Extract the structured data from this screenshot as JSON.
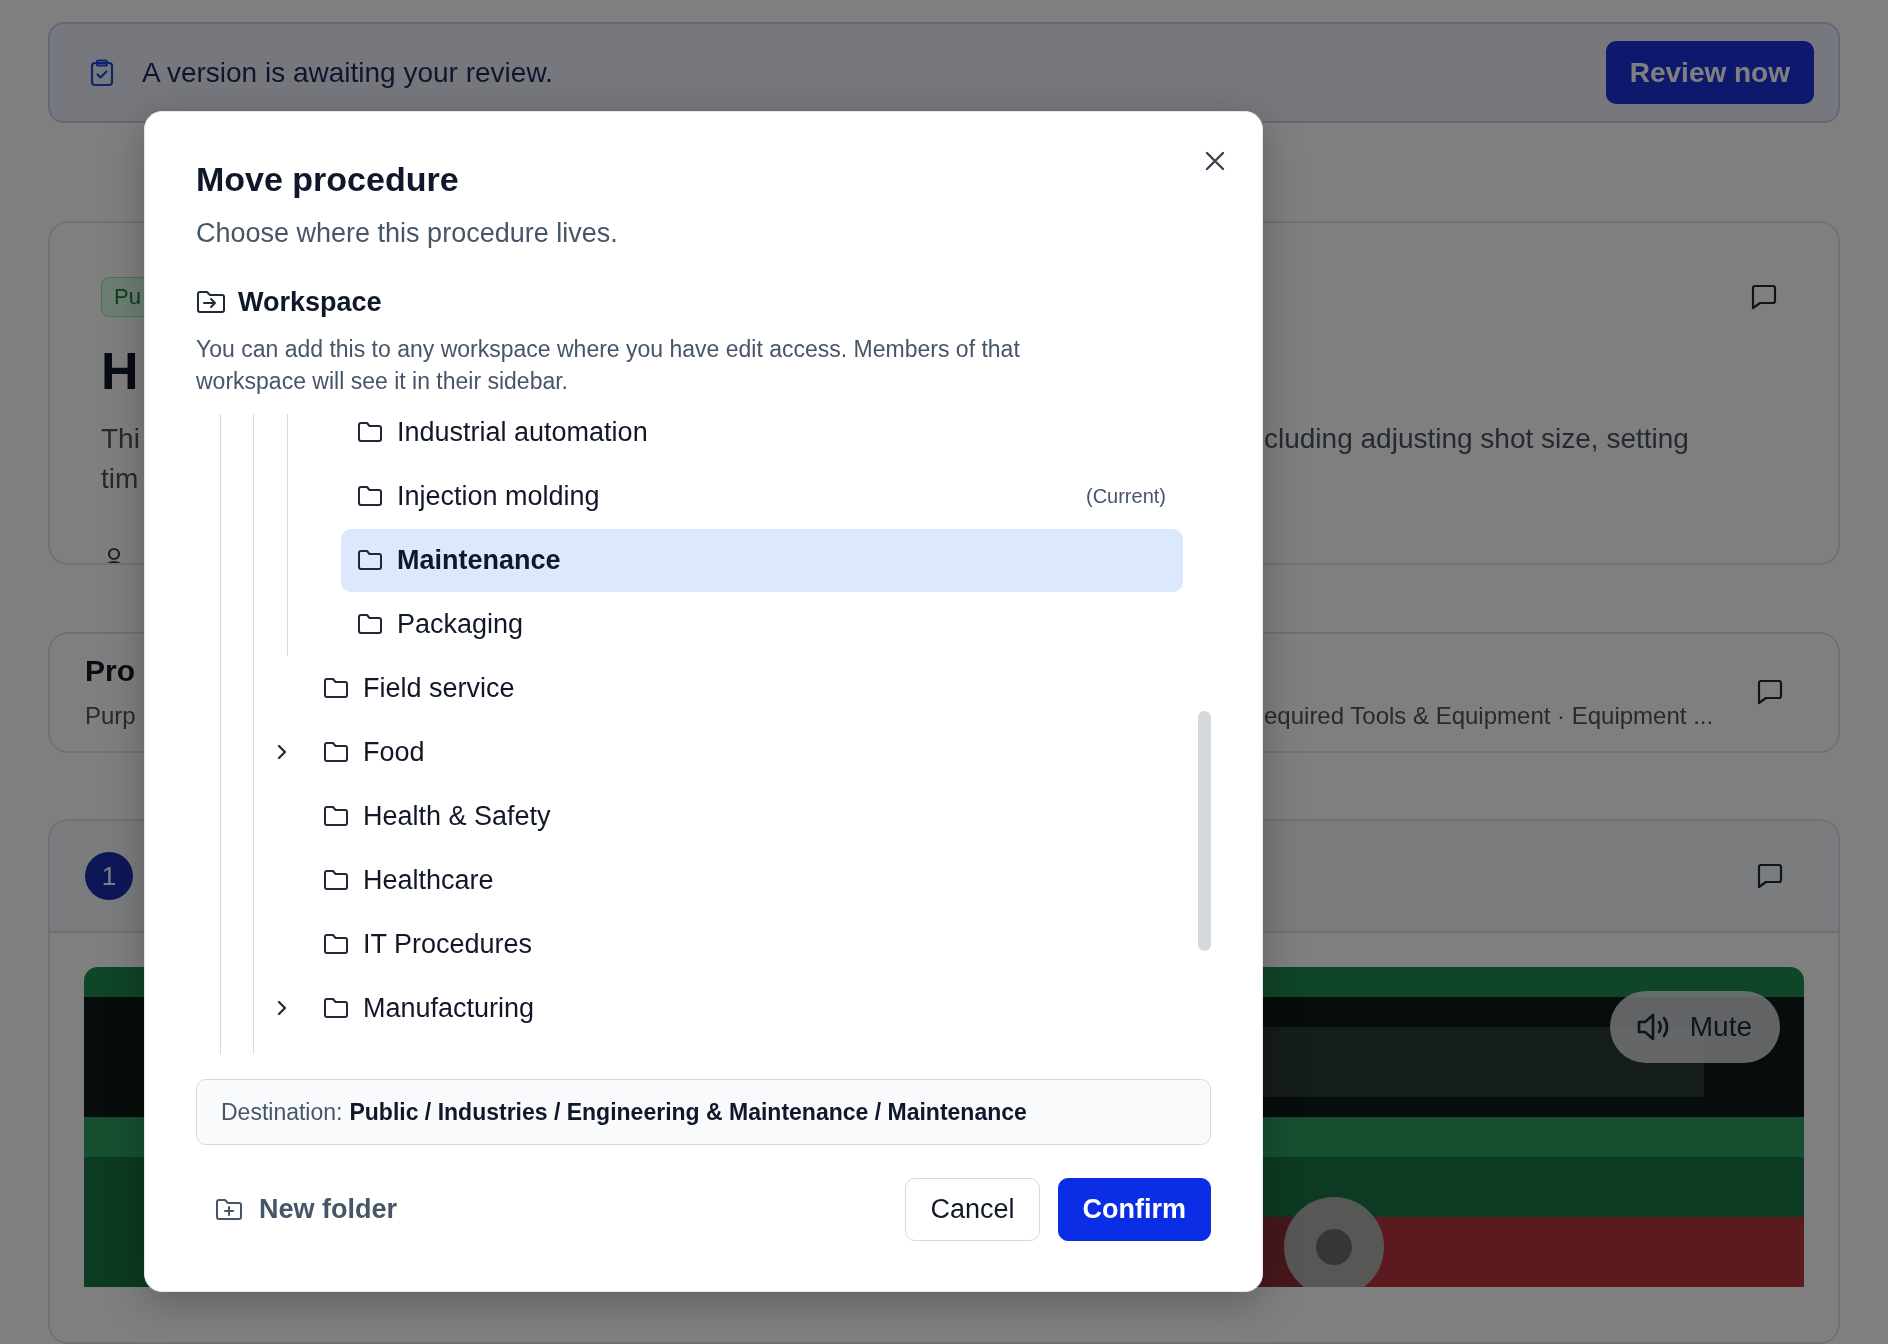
{
  "banner": {
    "message": "A version is awaiting your review.",
    "action": "Review now"
  },
  "cards": [
    {
      "kind": "overview",
      "badge": "Pu",
      "title": "H",
      "text_start": [
        "Thi",
        "tim"
      ],
      "text_end": "cluding adjusting shot size, setting"
    },
    {
      "kind": "section",
      "title": "Pro",
      "text_start": "Purp",
      "text_end": "equired Tools & Equipment · Equipment ..."
    },
    {
      "kind": "step",
      "number": "1",
      "video": {
        "kind": "picture",
        "button": "Mute"
      }
    }
  ],
  "dialog": {
    "title": "Move procedure",
    "subtitle": "Choose where this procedure lives.",
    "section": {
      "title": "Workspace",
      "description": "You can add this to any workspace where you have edit access. Members of that workspace will see it in their sidebar."
    },
    "folders": [
      {
        "children": [
          {
            "label": "Industrial automation",
            "selected": false,
            "expandable": false
          },
          {
            "label": "Injection molding",
            "note": "(Current)",
            "selected": false,
            "expandable": false
          },
          {
            "label": "Maintenance",
            "selected": true,
            "expandable": false
          },
          {
            "label": "Packaging",
            "selected": false,
            "expandable": false
          }
        ]
      },
      {
        "label": "Field service",
        "selected": false,
        "expandable": false
      },
      {
        "label": "Food",
        "selected": false,
        "expandable": true,
        "expanded": false
      },
      {
        "label": "Health & Safety",
        "selected": false,
        "expandable": false
      },
      {
        "label": "Healthcare",
        "selected": false,
        "expandable": false
      },
      {
        "label": "IT Procedures",
        "selected": false,
        "expandable": false
      },
      {
        "label": "Manufacturing",
        "selected": false,
        "expandable": true,
        "expanded": false
      }
    ],
    "destination": {
      "label": "Destination:",
      "path": "Public / Industries / Engineering & Maintenance / Maintenance"
    },
    "new_folder": "New folder",
    "buttons": [
      {
        "label": "Cancel",
        "kind": "secondary"
      },
      {
        "label": "Confirm",
        "kind": "primary"
      }
    ]
  }
}
